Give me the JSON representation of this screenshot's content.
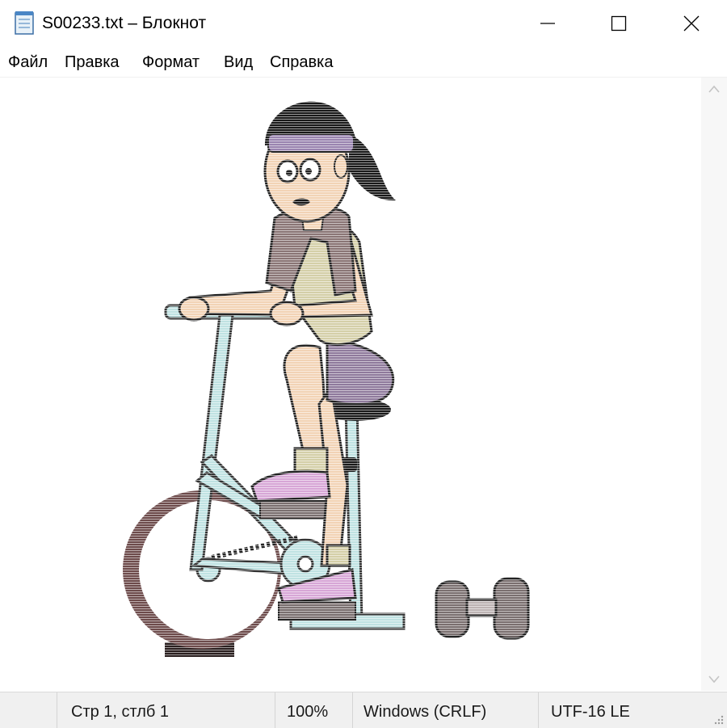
{
  "window": {
    "title": "S00233.txt – Блокнот",
    "icon": "notepad-icon",
    "controls": [
      "minimize-icon",
      "maximize-icon",
      "close-icon"
    ]
  },
  "menu": [
    "Файл",
    "Правка",
    "Формат",
    "Вид",
    "Справка"
  ],
  "editor": {
    "content": "ascii-art-cyclist-on-exercise-bike-with-dumbbell",
    "colors": {
      "hair": "#1a1a1a",
      "headband": "#9a84b0",
      "skin": "#f2d3b5",
      "towel": "#8a7575",
      "top": "#d4cfa8",
      "shorts": "#8f7a9c",
      "bike_frame": "#bfe2e2",
      "wheel": "#6d4b4b",
      "shoe": "#d7a6d6",
      "dumbbell": "#7a6f6f"
    }
  },
  "status": {
    "position": "Стр 1, стлб 1",
    "zoom": "100%",
    "line_endings": "Windows (CRLF)",
    "encoding": "UTF-16 LE"
  }
}
